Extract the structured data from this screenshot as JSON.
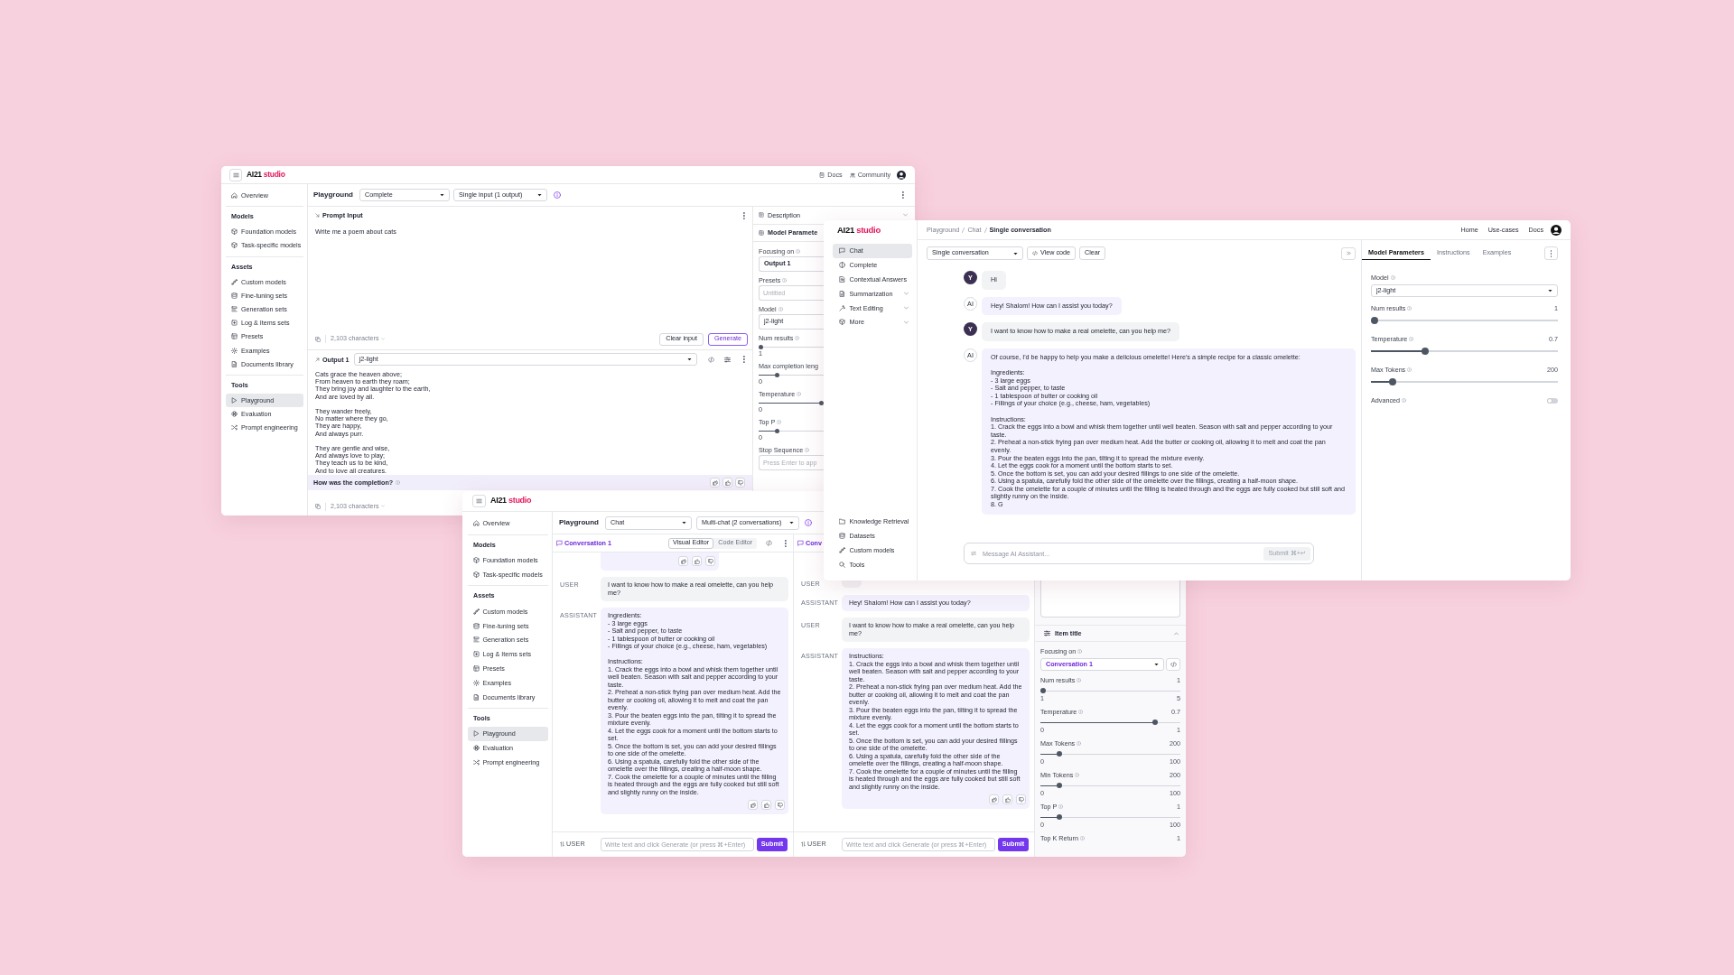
{
  "complete_window": {
    "logo": {
      "brand": "AI21",
      "product": "studio"
    },
    "top_links": [
      {
        "label": "Docs"
      },
      {
        "label": "Community"
      }
    ],
    "sidebar": {
      "top": [
        {
          "label": "Overview",
          "selected": false
        }
      ],
      "sections": [
        {
          "title": "Models",
          "items": [
            {
              "label": "Foundation models",
              "selected": false
            },
            {
              "label": "Task-specific models",
              "selected": false
            }
          ]
        },
        {
          "title": "Assets",
          "items": [
            {
              "label": "Custom models",
              "selected": false
            },
            {
              "label": "Fine-tuning sets",
              "selected": false
            },
            {
              "label": "Generation sets",
              "selected": false
            },
            {
              "label": "Log & Items sets",
              "selected": false
            },
            {
              "label": "Presets",
              "selected": false
            },
            {
              "label": "Examples",
              "selected": false
            },
            {
              "label": "Documents library",
              "selected": false
            }
          ]
        },
        {
          "title": "Tools",
          "items": [
            {
              "label": "Playground",
              "selected": true
            },
            {
              "label": "Evaluation",
              "selected": false
            },
            {
              "label": "Prompt engineering",
              "selected": false
            }
          ]
        }
      ]
    },
    "header": {
      "title": "Playground",
      "mode": "Complete",
      "layout": "Single input (1 output)"
    },
    "prompt": {
      "title": "Prompt Input",
      "text": "Write me a poem about cats",
      "char_count": "2,103 characters",
      "buttons": [
        {
          "label": "Clear input",
          "kind": "secondary"
        },
        {
          "label": "Generate",
          "kind": "primary"
        }
      ]
    },
    "output": {
      "title": "Output 1",
      "model": "j2-light",
      "text": "Cats grace the heaven above;\nFrom heaven to earth they roam;\nThey bring joy and laughter to the earth,\nAnd are loved by all.\n\nThey wander freely,\nNo matter where they go,\nThey are happy,\nAnd always purr.\n\nThey are gentle and wise,\nAnd always love to play;\nThey teach us to be kind,\nAnd to love all creatures.",
      "feedback_prompt": "How was the completion?",
      "char_count": "2,103 characters"
    },
    "panel": {
      "sections": [
        {
          "label": "Description",
          "expanded": false
        },
        {
          "label": "Model Paramete"
        }
      ],
      "params": [
        {
          "kind": "select",
          "label": "Focusing on",
          "info": true,
          "value": "Output 1"
        },
        {
          "kind": "input",
          "label": "Presets",
          "info": true,
          "placeholder": "Untitled"
        },
        {
          "kind": "select",
          "label": "Model",
          "info": true,
          "value": "j2-light"
        },
        {
          "kind": "slider",
          "label": "Num results",
          "info": true,
          "level": 0,
          "min": "1"
        },
        {
          "kind": "slider",
          "label": "Max completion leng",
          "info": false,
          "level": 0.27,
          "min": "0"
        },
        {
          "kind": "slider",
          "label": "Temperature",
          "info": true,
          "level": 1,
          "min": "0"
        },
        {
          "kind": "slider",
          "label": "Top P",
          "info": true,
          "level": 0.27,
          "min": "0"
        },
        {
          "kind": "input",
          "label": "Stop Sequence",
          "info": true,
          "placeholder": "Press Enter to app"
        }
      ]
    }
  },
  "chat_window": {
    "logo": {
      "brand": "AI21",
      "product": "studio"
    },
    "nav": [
      {
        "label": "Chat",
        "selected": true,
        "expandable": false
      },
      {
        "label": "Complete",
        "selected": false,
        "expandable": false
      },
      {
        "label": "Contextual Answers",
        "selected": false,
        "expandable": false
      },
      {
        "label": "Summarization",
        "selected": false,
        "expandable": true
      },
      {
        "label": "Text Editing",
        "selected": false,
        "expandable": true
      },
      {
        "label": "More",
        "selected": false,
        "expandable": true
      }
    ],
    "nav_bottom": [
      {
        "label": "Knowledge Retrieval"
      },
      {
        "label": "Datasets"
      },
      {
        "label": "Custom models"
      },
      {
        "label": "Tools"
      }
    ],
    "breadcrumb": [
      "Playground",
      "Chat",
      "Single conversation"
    ],
    "top_links": [
      {
        "label": "Home"
      },
      {
        "label": "Use-cases"
      },
      {
        "label": "Docs"
      }
    ],
    "toolbar": {
      "mode": "Single conversation",
      "view_code": "View code",
      "clear": "Clear"
    },
    "messages": [
      {
        "kind": "user",
        "avatar": "Y",
        "text": "Hi"
      },
      {
        "kind": "assistant",
        "avatar": "AI",
        "text": "Hey! Shalom! How can I assist you today?"
      },
      {
        "kind": "user",
        "avatar": "Y",
        "text": "I want to know how to make a real omelette, can you help me?"
      },
      {
        "kind": "assistant",
        "avatar": "AI",
        "text": "Of course, I'd be happy to help you make a delicious omelette! Here's a simple recipe for a classic omelette:\n\nIngredients:\n- 3 large eggs\n- Salt and pepper, to taste\n- 1 tablespoon of butter or cooking oil\n- Fillings of your choice (e.g., cheese, ham, vegetables)\n\nInstructions:\n1. Crack the eggs into a bowl and whisk them together until well beaten. Season with salt and pepper according to your taste.\n2. Preheat a non-stick frying pan over medium heat. Add the butter or cooking oil, allowing it to melt and coat the pan evenly.\n3. Pour the beaten eggs into the pan, tilting it to spread the mixture evenly.\n4. Let the eggs cook for a moment until the bottom starts to set.\n5. Once the bottom is set, you can add your desired fillings to one side of the omelette.\n6. Using a spatula, carefully fold the other side of the omelette over the fillings, creating a half-moon shape.\n7. Cook the omelette for a couple of minutes until the filling is heated through and the eggs are fully cooked but still soft and slightly runny on the inside.\n8. G"
      }
    ],
    "composer": {
      "placeholder": "Message AI Assistant...",
      "submit": "Submit ⌘+↵",
      "submit_disabled": true
    },
    "panel": {
      "tabs": [
        {
          "label": "Model Parameters",
          "selected": true
        },
        {
          "label": "Instructions",
          "selected": false
        },
        {
          "label": "Examples",
          "selected": false
        }
      ],
      "params": [
        {
          "kind": "select",
          "label": "Model",
          "value": "j2-light"
        },
        {
          "kind": "slider",
          "label": "Num results",
          "value": "1",
          "level": 0
        },
        {
          "kind": "slider",
          "label": "Temperature",
          "value": "0.7",
          "level": 0.28
        },
        {
          "kind": "slider",
          "label": "Max Tokens",
          "value": "200",
          "level": 0.1
        },
        {
          "kind": "toggle",
          "label": "Advanced",
          "on": false
        }
      ]
    }
  },
  "multichat_window": {
    "logo": {
      "brand": "AI21",
      "product": "studio"
    },
    "sidebar": {
      "top": [
        {
          "label": "Overview",
          "selected": false
        }
      ],
      "sections": [
        {
          "title": "Models",
          "items": [
            {
              "label": "Foundation models",
              "selected": false
            },
            {
              "label": "Task-specific models",
              "selected": false
            }
          ]
        },
        {
          "title": "Assets",
          "items": [
            {
              "label": "Custom models",
              "selected": false
            },
            {
              "label": "Fine-tuning sets",
              "selected": false
            },
            {
              "label": "Generation sets",
              "selected": false
            },
            {
              "label": "Log & Items sets",
              "selected": false
            },
            {
              "label": "Presets",
              "selected": false
            },
            {
              "label": "Examples",
              "selected": false
            },
            {
              "label": "Documents library",
              "selected": false
            }
          ]
        },
        {
          "title": "Tools",
          "items": [
            {
              "label": "Playground",
              "selected": true
            },
            {
              "label": "Evaluation",
              "selected": false
            },
            {
              "label": "Prompt engineering",
              "selected": false
            }
          ]
        }
      ]
    },
    "header": {
      "title": "Playground",
      "mode": "Chat",
      "layout": "Multi-chat (2 conversations)"
    },
    "conversations": [
      {
        "title": "Conversation 1",
        "editor_tabs": [
          {
            "label": "Visual Editor",
            "selected": true
          },
          {
            "label": "Code Editor",
            "selected": false
          }
        ],
        "messages": [
          {
            "kind": "assistant",
            "feedback": true
          },
          {
            "kind": "user",
            "label": "USER",
            "text": "I want to know how to make a real omelette, can you help me?",
            "feedback": false
          },
          {
            "kind": "assistant",
            "label": "ASSISTANT",
            "text": "Ingredients:\n- 3 large eggs\n- Salt and pepper, to taste\n- 1 tablespoon of butter or cooking oil\n- Fillings of your choice (e.g., cheese, ham, vegetables)\n\nInstructions:\n1. Crack the eggs into a bowl and whisk them together until well beaten. Season with salt and pepper according to your taste.\n2. Preheat a non-stick frying pan over medium heat. Add the butter or cooking oil, allowing it to melt and coat the pan evenly.\n3. Pour the beaten eggs into the pan, tilting it to spread the mixture evenly.\n4. Let the eggs cook for a moment until the bottom starts to set.\n5. Once the bottom is set, you can add your desired fillings to one side of the omelette.\n6. Using a spatula, carefully fold the other side of the omelette over the fillings, creating a half-moon shape.\n7. Cook the omelette for a couple of minutes until the filling is heated through and the eggs are fully cooked but still soft and slightly runny on the inside.",
            "feedback": true
          }
        ],
        "composer": {
          "role": "USER",
          "placeholder": "Write text and click Generate (or press ⌘+Enter)",
          "submit": "Submit"
        }
      },
      {
        "title": "Conv",
        "messages": [
          {
            "kind": "user",
            "label": "USER",
            "feedback": false
          },
          {
            "kind": "assistant",
            "label": "ASSISTANT",
            "text": "Hey! Shalom! How can I assist you today?",
            "feedback": false
          },
          {
            "kind": "user",
            "label": "USER",
            "text": "I want to know how to make a real omelette, can you help me?",
            "feedback": false
          },
          {
            "kind": "assistant",
            "label": "ASSISTANT",
            "text": "Instructions:\n1. Crack the eggs into a bowl and whisk them together until well beaten. Season with salt and pepper according to your taste.\n2. Preheat a non-stick frying pan over medium heat. Add the butter or cooking oil, allowing it to melt and coat the pan evenly.\n3. Pour the beaten eggs into the pan, tilting it to spread the mixture evenly.\n4. Let the eggs cook for a moment until the bottom starts to set.\n5. Once the bottom is set, you can add your desired fillings to one side of the omelette.\n6. Using a spatula, carefully fold the other side of the omelette over the fillings, creating a half-moon shape.\n7. Cook the omelette for a couple of minutes until the filling is heated through and the eggs are fully cooked but still soft and slightly runny on the inside.",
            "feedback": true
          }
        ],
        "composer": {
          "role": "USER",
          "placeholder": "Write text and click Generate (or press ⌘+Enter)",
          "submit": "Submit"
        }
      }
    ],
    "settings": {
      "section": "Item title",
      "expanded": true,
      "focus_label": "Focusing on",
      "focus_value": "Conversation 1",
      "params": [
        {
          "kind": "slider",
          "label": "Num results",
          "value": "1",
          "level": 0,
          "min": "1",
          "max": "5"
        },
        {
          "kind": "slider",
          "label": "Temperature",
          "value": "0.7",
          "level": 0.83,
          "min": "0",
          "max": "1"
        },
        {
          "kind": "slider",
          "label": "Max Tokens",
          "value": "200",
          "level": 0.12,
          "min": "0",
          "max": "100"
        },
        {
          "kind": "slider",
          "label": "Min Tokens",
          "value": "200",
          "level": 0.12,
          "min": "0",
          "max": "100"
        },
        {
          "kind": "slider",
          "label": "Top P",
          "value": "1",
          "level": 0.12,
          "min": "0",
          "max": "100"
        },
        {
          "kind": "label",
          "label": "Top K Return",
          "value": "1"
        }
      ]
    }
  }
}
